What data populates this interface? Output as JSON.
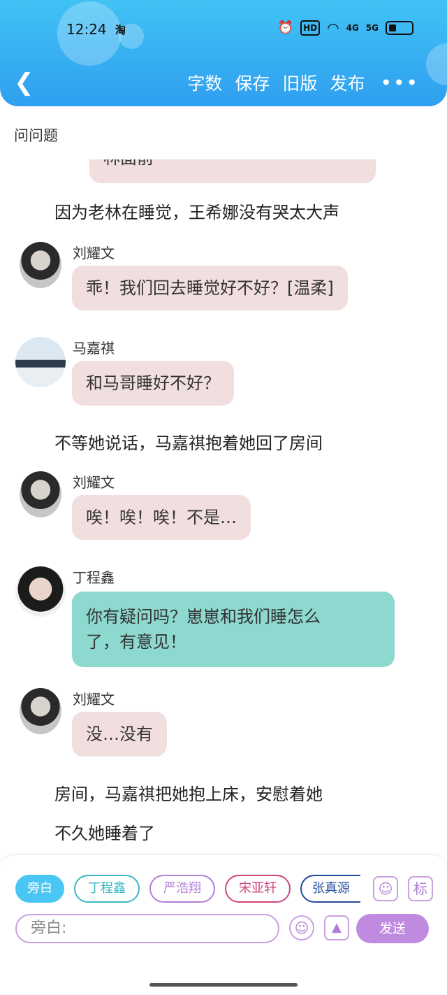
{
  "status_bar": {
    "time": "12:24",
    "carrier_icon": "淘",
    "hd_icon": "HD",
    "sig1": "4G",
    "sig2": "5G"
  },
  "header": {
    "toolbar": [
      "字数",
      "保存",
      "旧版",
      "发布"
    ],
    "more": "•••"
  },
  "chat": {
    "title": "问问题",
    "partial_top": "林面前",
    "items": [
      {
        "kind": "narration",
        "text": "因为老林在睡觉，王希娜没有哭太大声"
      },
      {
        "kind": "msg",
        "sender": "刘耀文",
        "text": "乖！我们回去睡觉好不好？[温柔]",
        "style": "pink"
      },
      {
        "kind": "msg",
        "sender": "马嘉祺",
        "text": "和马哥睡好不好？",
        "style": "pink"
      },
      {
        "kind": "narration",
        "text": "不等她说话，马嘉祺抱着她回了房间"
      },
      {
        "kind": "msg",
        "sender": "刘耀文",
        "text": "唉！唉！唉！不是…",
        "style": "pink"
      },
      {
        "kind": "msg",
        "sender": "丁程鑫",
        "text_line1": "你有疑问吗？崽崽和我们睡怎么",
        "text_line2": "了，有意见！",
        "style": "green"
      },
      {
        "kind": "msg",
        "sender": "刘耀文",
        "text": "没…没有",
        "style": "pink"
      },
      {
        "kind": "narration",
        "text": "房间，马嘉祺把她抱上床，安慰着她"
      },
      {
        "kind": "narration",
        "text": "不久她睡着了"
      }
    ]
  },
  "composer": {
    "chips": [
      {
        "label": "旁白",
        "color": "#4ac6f4"
      },
      {
        "label": "丁程鑫",
        "color": "#3cb7c4"
      },
      {
        "label": "严浩翔",
        "color": "#b27fd8"
      },
      {
        "label": "宋亚轩",
        "color": "#d0457f"
      },
      {
        "label": "张真源",
        "color": "#244a9e"
      }
    ],
    "tag_icon_label": "标",
    "input_text": "旁白:",
    "send_label": "发送"
  }
}
